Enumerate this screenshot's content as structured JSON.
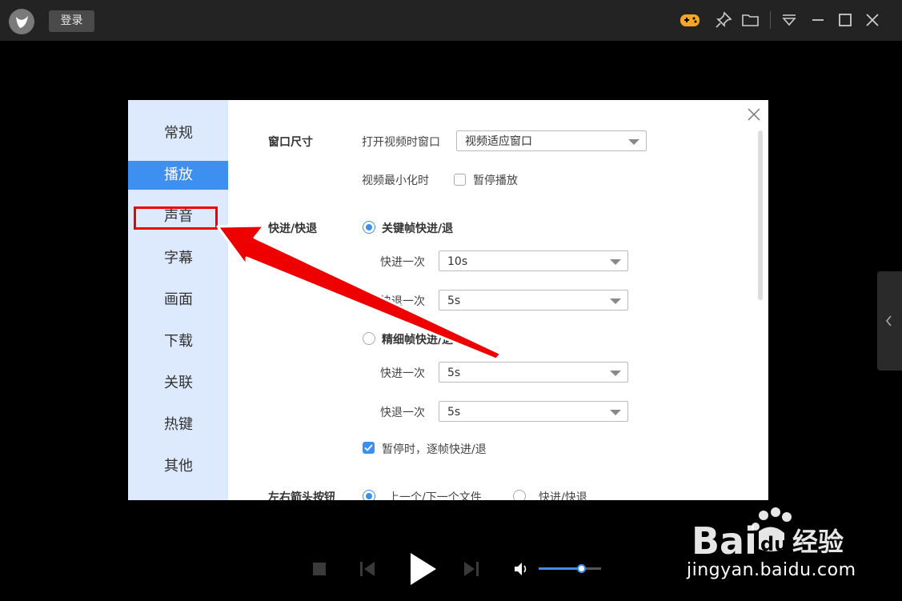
{
  "titlebar": {
    "login_label": "登录"
  },
  "settings": {
    "nav": [
      "常规",
      "播放",
      "声音",
      "字幕",
      "画面",
      "下载",
      "关联",
      "热键",
      "其他"
    ],
    "active_nav": "播放",
    "window_size": {
      "section": "窗口尺寸",
      "open_label": "打开视频时窗口",
      "open_value": "视频适应窗口",
      "minimize_label": "视频最小化时",
      "pause_label": "暂停播放"
    },
    "seek": {
      "section": "快进/快退",
      "keyframe_label": "关键帧快进/退",
      "forward_label": "快进一次",
      "forward_value": "10s",
      "back_label": "快退一次",
      "back_value": "5s",
      "fine_label": "精细帧快进/退",
      "fine_forward_label": "快进一次",
      "fine_forward_value": "5s",
      "fine_back_label": "快退一次",
      "fine_back_value": "5s",
      "frame_step_label": "暂停时，逐帧快进/退"
    },
    "arrow_keys": {
      "section": "左右箭头按钮",
      "opt1": "上一个/下一个文件",
      "opt2": "快进/快退"
    }
  },
  "player": {
    "volume_level": 0.68
  },
  "watermark": {
    "brand": "Bai du 经验",
    "url": "jingyan.baidu.com"
  },
  "colors": {
    "accent": "#3d8ff0",
    "annotation": "#e00000",
    "game_icon": "#f5a623"
  }
}
